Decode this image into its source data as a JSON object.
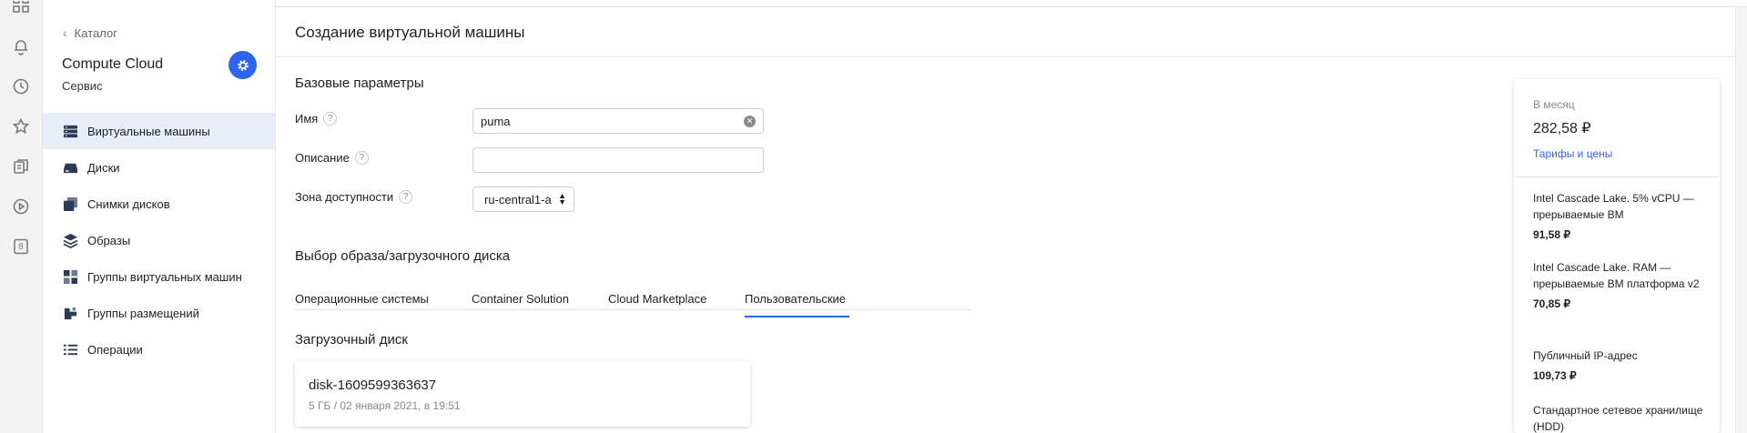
{
  "sidebar": {
    "back_label": "Каталог",
    "service_title": "Compute Cloud",
    "service_subtitle": "Сервис",
    "items": [
      {
        "label": "Виртуальные машины",
        "icon": "servers-icon",
        "active": true
      },
      {
        "label": "Диски",
        "icon": "disk-icon",
        "active": false
      },
      {
        "label": "Снимки дисков",
        "icon": "snapshots-icon",
        "active": false
      },
      {
        "label": "Образы",
        "icon": "images-icon",
        "active": false
      },
      {
        "label": "Группы виртуальных машин",
        "icon": "instance-groups-icon",
        "active": false
      },
      {
        "label": "Группы размещений",
        "icon": "placement-groups-icon",
        "active": false
      },
      {
        "label": "Операции",
        "icon": "operations-icon",
        "active": false
      }
    ]
  },
  "rail": {
    "icons": [
      "grid-icon",
      "bell-icon",
      "clock-icon",
      "star-icon",
      "documents-icon",
      "play-icon",
      "number-8-icon"
    ],
    "badge": "8"
  },
  "page": {
    "title": "Создание виртуальной машины"
  },
  "basic": {
    "section_title": "Базовые параметры",
    "name_label": "Имя",
    "name_value": "puma",
    "description_label": "Описание",
    "description_value": "",
    "zone_label": "Зона доступности",
    "zone_value": "ru-central1-a",
    "help_glyph": "?"
  },
  "image": {
    "section_title": "Выбор образа/загрузочного диска",
    "tabs": [
      {
        "label": "Операционные системы",
        "active": false
      },
      {
        "label": "Container Solution",
        "active": false
      },
      {
        "label": "Cloud Marketplace",
        "active": false
      },
      {
        "label": "Пользовательские",
        "active": true
      }
    ],
    "boot_disk_title": "Загрузочный диск",
    "disk_name": "disk-1609599363637",
    "disk_meta": "5 ГБ / 02 января 2021, в 19:51"
  },
  "pricing": {
    "per_month_label": "В месяц",
    "total": "282,58 ₽",
    "link": "Тарифы и цены",
    "items": [
      {
        "name": "Intel Cascade Lake. 5% vCPU — прерываемые ВМ",
        "value": "91,58 ₽"
      },
      {
        "name": "Intel Cascade Lake. RAM — прерываемые ВМ платформа v2",
        "value": "70,85 ₽"
      },
      {
        "name": "Публичный IP-адрес",
        "value": "109,73 ₽"
      },
      {
        "name": "Стандартное сетевое хранилище (HDD)",
        "value": ""
      }
    ]
  },
  "colors": {
    "accent": "#2c66f0",
    "active_nav_bg": "#e8edf7"
  }
}
